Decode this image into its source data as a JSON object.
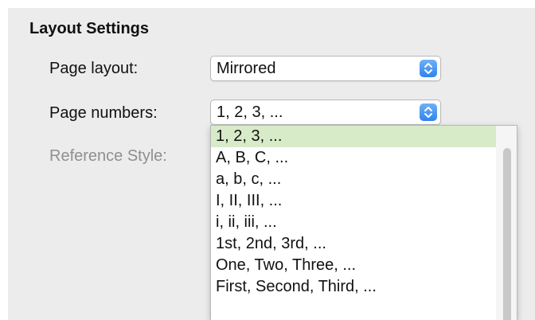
{
  "section": {
    "title": "Layout Settings"
  },
  "fields": {
    "page_layout": {
      "label": "Page layout:",
      "value": "Mirrored"
    },
    "page_numbers": {
      "label": "Page numbers:",
      "value": "1, 2, 3, ..."
    },
    "reference_style": {
      "label": "Reference Style:"
    }
  },
  "dropdown": {
    "selected_index": 0,
    "options": [
      "1, 2, 3, ...",
      "A, B, C, ...",
      "a, b, c, ...",
      "I, II, III, ...",
      "i, ii, iii, ...",
      "1st, 2nd, 3rd, ...",
      "One, Two, Three, ...",
      "First, Second, Third, ..."
    ]
  },
  "colors": {
    "selected_option_background": "#d8ebc9",
    "stepper_accent": "#2f84ee",
    "disabled_label": "#8f8f8f"
  },
  "icons": {
    "combo_stepper": "up-down-chevron-icon",
    "scrollbar": "vertical-scrollbar"
  }
}
